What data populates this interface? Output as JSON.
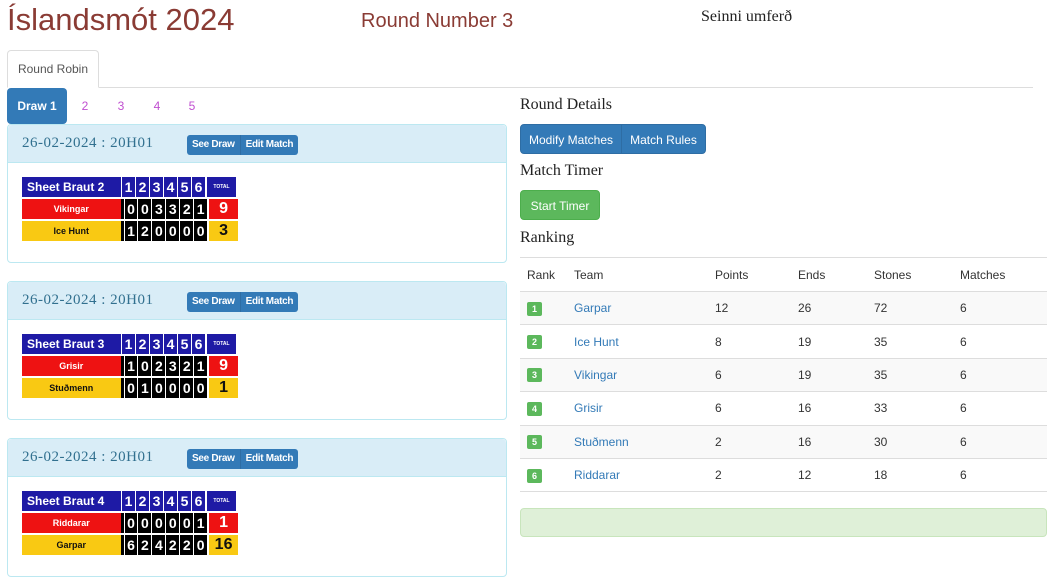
{
  "header": {
    "title": "Íslandsmót 2024",
    "round": "Round Number 3",
    "sub": "Seinni umferð"
  },
  "tabs": [
    {
      "label": "Round Robin"
    }
  ],
  "pills": [
    {
      "label": "Draw 1",
      "active": true
    },
    {
      "label": "2"
    },
    {
      "label": "3"
    },
    {
      "label": "4"
    },
    {
      "label": "5"
    }
  ],
  "draws": [
    {
      "date": "26-02-2024 : 20H01",
      "see_draw": "See Draw",
      "edit_match": "Edit Match",
      "sheet": "Sheet Braut 2",
      "ends": [
        "1",
        "2",
        "3",
        "4",
        "5",
        "6"
      ],
      "total_label": "TOTAL",
      "red": {
        "team": "Vikingar",
        "scores": [
          "0",
          "0",
          "3",
          "3",
          "2",
          "1"
        ],
        "total": "9"
      },
      "yellow": {
        "team": "Ice Hunt",
        "scores": [
          "1",
          "2",
          "0",
          "0",
          "0",
          "0"
        ],
        "total": "3"
      }
    },
    {
      "date": "26-02-2024 : 20H01",
      "see_draw": "See Draw",
      "edit_match": "Edit Match",
      "sheet": "Sheet Braut 3",
      "ends": [
        "1",
        "2",
        "3",
        "4",
        "5",
        "6"
      ],
      "total_label": "TOTAL",
      "red": {
        "team": "Grisir",
        "scores": [
          "1",
          "0",
          "2",
          "3",
          "2",
          "1"
        ],
        "total": "9"
      },
      "yellow": {
        "team": "Stuðmenn",
        "scores": [
          "0",
          "1",
          "0",
          "0",
          "0",
          "0"
        ],
        "total": "1"
      }
    },
    {
      "date": "26-02-2024 : 20H01",
      "see_draw": "See Draw",
      "edit_match": "Edit Match",
      "sheet": "Sheet Braut 4",
      "ends": [
        "1",
        "2",
        "3",
        "4",
        "5",
        "6"
      ],
      "total_label": "TOTAL",
      "red": {
        "team": "Riddarar",
        "scores": [
          "0",
          "0",
          "0",
          "0",
          "0",
          "1"
        ],
        "total": "1"
      },
      "yellow": {
        "team": "Garpar",
        "scores": [
          "6",
          "2",
          "4",
          "2",
          "2",
          "0"
        ],
        "total": "16"
      }
    }
  ],
  "right": {
    "round_details": "Round Details",
    "modify_matches": "Modify Matches",
    "match_rules": "Match Rules",
    "match_timer": "Match Timer",
    "start_timer": "Start Timer",
    "ranking": "Ranking"
  },
  "ranking": {
    "headers": [
      "Rank",
      "Team",
      "Points",
      "Ends",
      "Stones",
      "Matches"
    ],
    "rows": [
      {
        "rank": "1",
        "team": "Garpar",
        "points": "12",
        "ends": "26",
        "stones": "72",
        "matches": "6"
      },
      {
        "rank": "2",
        "team": "Ice Hunt",
        "points": "8",
        "ends": "19",
        "stones": "35",
        "matches": "6"
      },
      {
        "rank": "3",
        "team": "Vikingar",
        "points": "6",
        "ends": "19",
        "stones": "35",
        "matches": "6"
      },
      {
        "rank": "4",
        "team": "Grisir",
        "points": "6",
        "ends": "16",
        "stones": "33",
        "matches": "6"
      },
      {
        "rank": "5",
        "team": "Stuðmenn",
        "points": "2",
        "ends": "16",
        "stones": "30",
        "matches": "6"
      },
      {
        "rank": "6",
        "team": "Riddarar",
        "points": "2",
        "ends": "12",
        "stones": "18",
        "matches": "6"
      }
    ]
  },
  "colors": {
    "primary": "#337ab7",
    "success": "#5cb85c",
    "title": "#8a3b34",
    "red_stone": "#ee1212",
    "yellow_stone": "#f9c913",
    "sheet_blue": "#1e1aa5"
  }
}
